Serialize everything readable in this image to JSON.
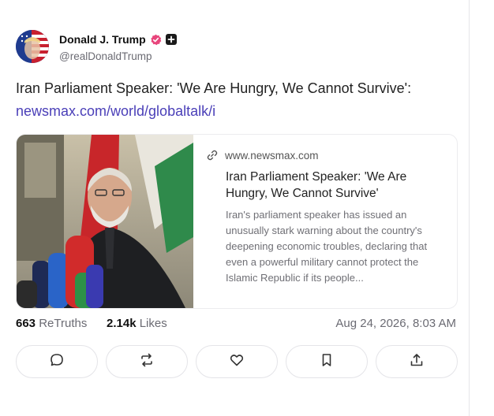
{
  "author": {
    "display_name": "Donald J. Trump",
    "handle": "@realDonaldTrump",
    "verified_icon": "verified-badge-icon",
    "plus_icon": "plus-icon"
  },
  "post": {
    "text": "Iran Parliament Speaker: 'We Are Hungry, We Cannot Survive':",
    "link_text": "newsmax.com/world/globaltalk/i"
  },
  "link_card": {
    "domain": "www.newsmax.com",
    "title": "Iran Parliament Speaker: 'We Are Hungry, We Cannot Survive'",
    "description": "Iran's parliament speaker has issued an unusually stark warning about the country's deepening economic troubles, declaring that even a powerful military cannot protect the Islamic Republic if its people..."
  },
  "stats": {
    "retruths_count": "663",
    "retruths_label": "ReTruths",
    "likes_count": "2.14k",
    "likes_label": "Likes",
    "timestamp": "Aug 24, 2026, 8:03 AM"
  },
  "actions": [
    {
      "name": "reply",
      "icon": "comment-icon"
    },
    {
      "name": "retruth",
      "icon": "repost-icon"
    },
    {
      "name": "like",
      "icon": "heart-icon"
    },
    {
      "name": "bookmark",
      "icon": "bookmark-icon"
    },
    {
      "name": "share",
      "icon": "share-icon"
    }
  ],
  "colors": {
    "link": "#4a3fb8",
    "verified": "#e8467c",
    "muted": "#6b6b73"
  }
}
